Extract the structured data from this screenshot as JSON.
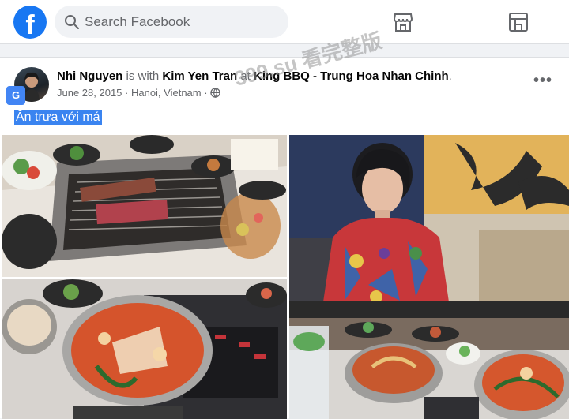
{
  "header": {
    "logo_letter": "f",
    "search_placeholder": "Search Facebook",
    "nav_icons": [
      "marketplace-icon",
      "pages-icon"
    ]
  },
  "post": {
    "author": "Nhi Nguyen",
    "with_text": "is with",
    "tagged": "Kim Yen Tran",
    "at_text": "at",
    "place": "King BBQ - Trung Hoa Nhan Chinh",
    "date": "June 28, 2015",
    "location": "Hanoi, Vietnam",
    "audience_icon": "globe-icon",
    "more": "•••",
    "text": "Ăn trưa với má",
    "translate_badge": "G",
    "watermark": "399.su 看完整版"
  },
  "photos": [
    {
      "description_icon": "bbq-grill-photo"
    },
    {
      "description_icon": "woman-portrait-photo"
    },
    {
      "description_icon": "hotpot-photo"
    },
    {
      "description_icon": "hotpot-table-photo"
    }
  ],
  "colors": {
    "brand": "#1877f2",
    "selection": "#3a84f0"
  }
}
